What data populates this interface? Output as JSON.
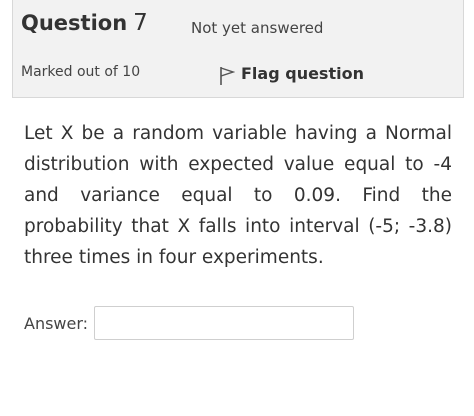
{
  "question": {
    "label": "Question",
    "number": "7",
    "state": "Not yet answered",
    "grade": "Marked out of 10",
    "flag_label": "Flag question",
    "flag_icon": "flag-outline-icon",
    "text": "Let X be a random variable having a Normal distribution with expected value equal to -4 and variance equal to 0.09. Find the probability that X falls into interval (-5; -3.8) three times in four experiments."
  },
  "answer": {
    "label": "Answer:",
    "value": ""
  }
}
